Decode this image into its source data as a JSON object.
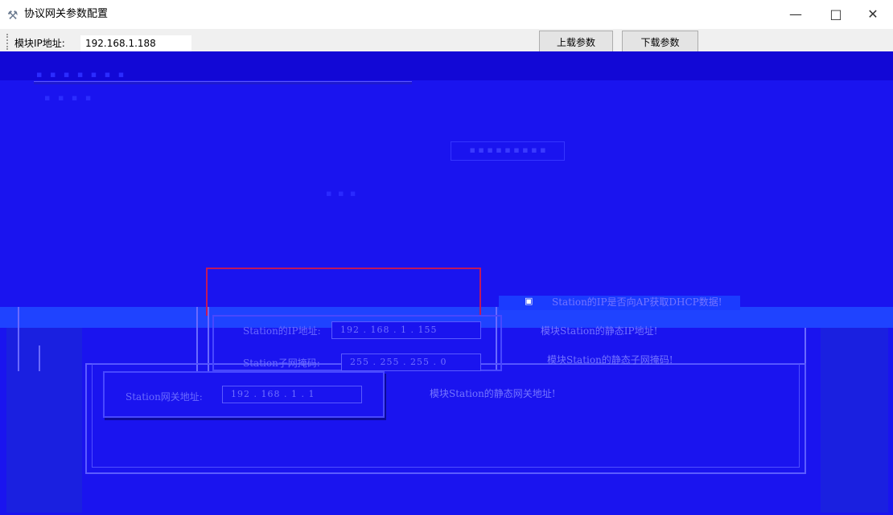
{
  "window": {
    "title": "协议网关参数配置",
    "icons": {
      "app": "tools-icon",
      "minimize": "minimize-icon",
      "maximize": "maximize-icon",
      "close": "close-icon"
    },
    "minimize_glyph": "—",
    "maximize_glyph": "□",
    "close_glyph": "✕"
  },
  "toolbar": {
    "ip_label": "模块IP地址:",
    "ip_value": "192.168.1.188",
    "upload_label": "上载参数",
    "download_label": "下载参数"
  },
  "station": {
    "ip_label": "Station的IP地址:",
    "ip_value": "192 . 168 . 1 . 155",
    "ip_desc": "模块Station的静态IP地址!",
    "mask_label": "Station子网掩码:",
    "mask_value": "255 . 255 . 255 . 0",
    "mask_desc": "模块Station的静态子网掩码!",
    "gateway_label": "Station网关地址:",
    "gateway_value": "192 . 168 . 1 . 1",
    "gateway_desc": "模块Station的静态网关地址!",
    "dhcp_desc": "Station的IP是否向AP获取DHCP数据!"
  },
  "colors": {
    "background_corrupt": "#1a14ef",
    "red_frame": "#c2185b"
  }
}
